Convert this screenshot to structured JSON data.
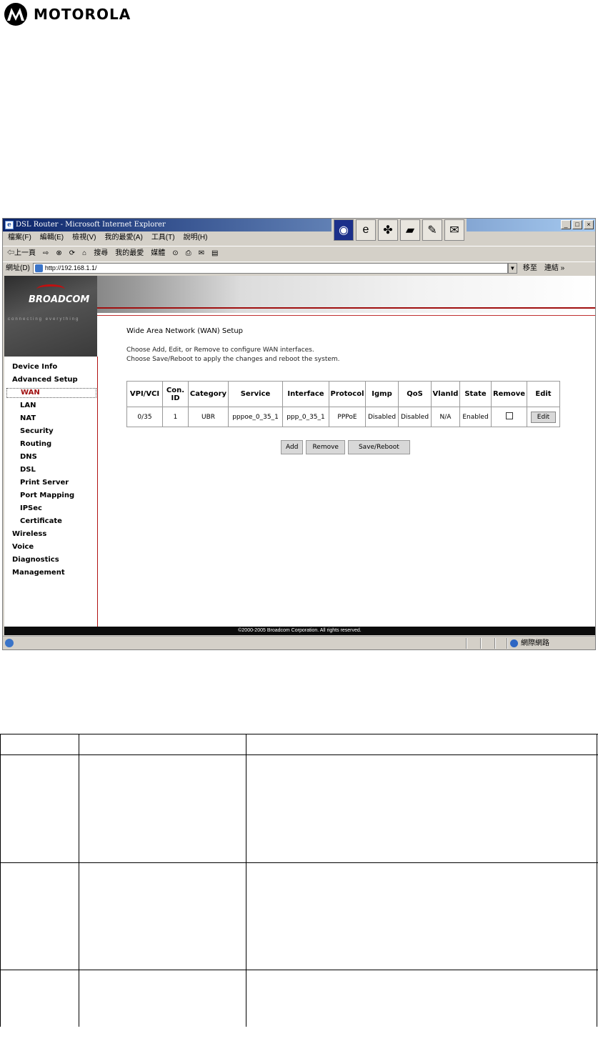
{
  "document": {
    "brand": "MOTOROLA"
  },
  "browser": {
    "title": "DSL Router - Microsoft Internet Explorer",
    "menu": [
      "檔案(F)",
      "編輯(E)",
      "檢視(V)",
      "我的最愛(A)",
      "工具(T)",
      "說明(H)"
    ],
    "toolbar": [
      "⇦上一頁",
      "⇨",
      "⊗",
      "⟳",
      "⌂",
      "搜尋",
      "我的最愛",
      "媒體",
      "⊙",
      "⎙",
      "✉",
      "▤"
    ],
    "address_label": "網址(D)",
    "url": "http://192.168.1.1/",
    "go_label": "移至",
    "links_label": "連結 »",
    "status_zone": "網際網路"
  },
  "router": {
    "brand": "BROADCOM",
    "tagline": "connecting everything",
    "sidebar": [
      {
        "label": "Device Info",
        "level": "top"
      },
      {
        "label": "Advanced Setup",
        "level": "top"
      },
      {
        "label": "WAN",
        "level": "sub",
        "active": true
      },
      {
        "label": "LAN",
        "level": "sub"
      },
      {
        "label": "NAT",
        "level": "sub"
      },
      {
        "label": "Security",
        "level": "sub"
      },
      {
        "label": "Routing",
        "level": "sub"
      },
      {
        "label": "DNS",
        "level": "sub"
      },
      {
        "label": "DSL",
        "level": "sub"
      },
      {
        "label": "Print Server",
        "level": "sub"
      },
      {
        "label": "Port Mapping",
        "level": "sub"
      },
      {
        "label": "IPSec",
        "level": "sub"
      },
      {
        "label": "Certificate",
        "level": "sub"
      },
      {
        "label": "Wireless",
        "level": "top"
      },
      {
        "label": "Voice",
        "level": "top"
      },
      {
        "label": "Diagnostics",
        "level": "top"
      },
      {
        "label": "Management",
        "level": "top"
      }
    ],
    "page_title": "Wide Area Network (WAN) Setup",
    "instructions": [
      "Choose Add, Edit, or Remove to configure WAN interfaces.",
      "Choose Save/Reboot to apply the changes and reboot the system."
    ],
    "table": {
      "headers": [
        "VPI/VCI",
        "Con. ID",
        "Category",
        "Service",
        "Interface",
        "Protocol",
        "Igmp",
        "QoS",
        "VlanId",
        "State",
        "Remove",
        "Edit"
      ],
      "rows": [
        [
          "0/35",
          "1",
          "UBR",
          "pppoe_0_35_1",
          "ppp_0_35_1",
          "PPPoE",
          "Disabled",
          "Disabled",
          "N/A",
          "Enabled",
          "",
          "Edit"
        ]
      ]
    },
    "buttons": {
      "add": "Add",
      "remove": "Remove",
      "save_reboot": "Save/Reboot"
    },
    "footer": "©2000-2005 Broadcom Corporation. All rights reserved."
  }
}
